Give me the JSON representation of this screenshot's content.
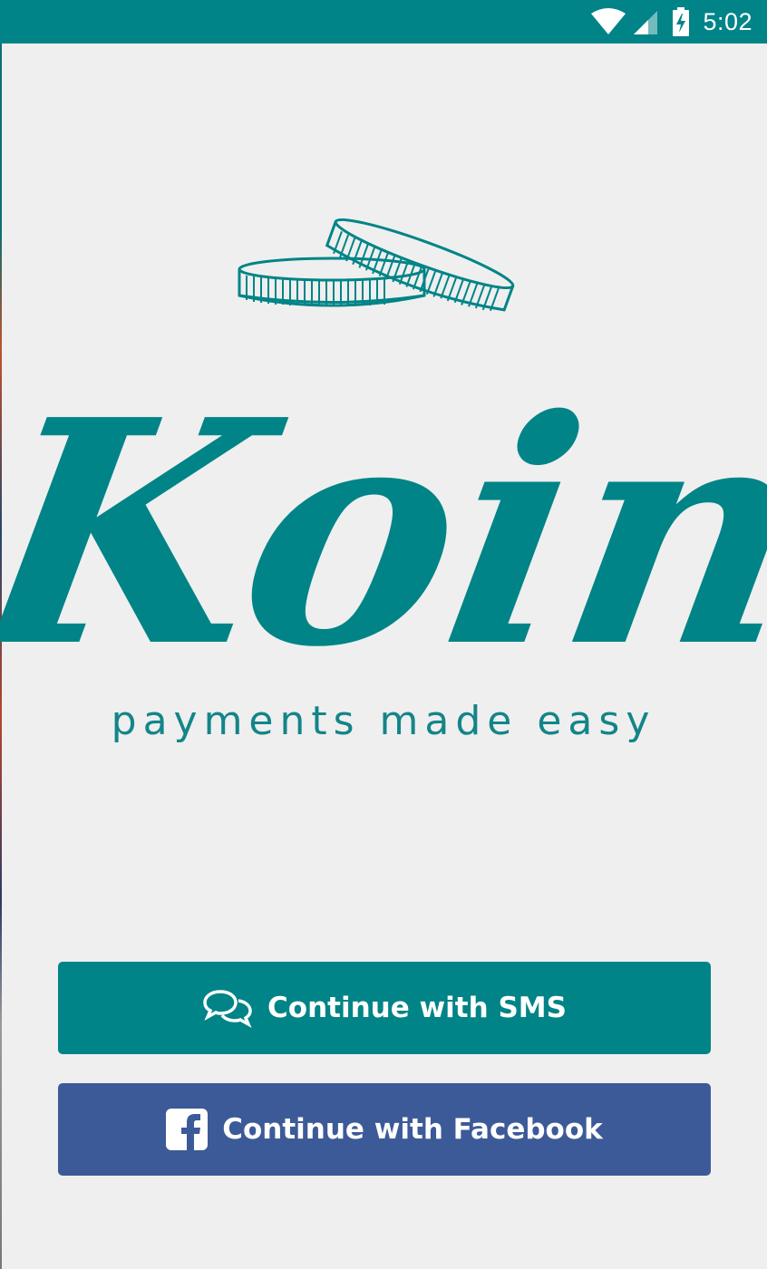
{
  "status_bar": {
    "time": "5:02",
    "icons": [
      "wifi-icon",
      "signal-icon",
      "battery-charging-icon"
    ],
    "color": "#008487"
  },
  "brand": {
    "logo_text": "Koin",
    "tagline": "payments made easy",
    "color": "#008487"
  },
  "buttons": {
    "sms": {
      "label": "Continue with SMS",
      "icon": "chat-bubbles-icon",
      "color": "#008487"
    },
    "facebook": {
      "label": "Continue with Facebook",
      "icon": "facebook-icon",
      "color": "#3d5a98"
    }
  }
}
